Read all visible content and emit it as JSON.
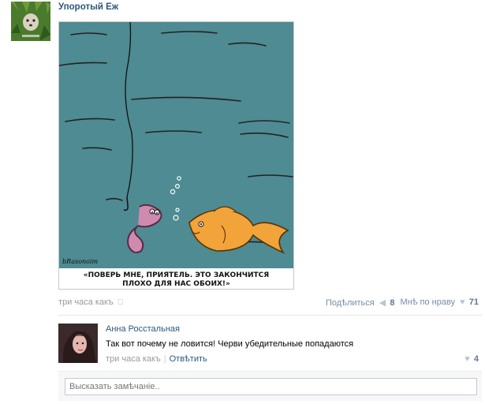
{
  "post": {
    "author": "Упоротый Еж",
    "caption_line1": "«ПОВЕРЬ МНЕ, ПРИЯТЕЛЬ. ЭТО ЗАКОНЧИТСЯ",
    "caption_line2": "ПЛОХО ДЛЯ НАС ОБОИХ!»",
    "signature": "bRasonoim",
    "time": "три часа какъ",
    "share_label": "Подѣлиться",
    "share_count": "8",
    "like_label": "Мнѣ по нраву",
    "like_count": "71"
  },
  "comment": {
    "author": "Анна Росстальная",
    "text": "Так вот почему не ловится! Черви убедительные попадаются",
    "time": "три часа какъ",
    "separator": "|",
    "reply_label": "Отвѣтить",
    "like_count": "4"
  },
  "reply_box": {
    "placeholder": "Высказать замѣчаніе.."
  },
  "icons": {
    "apple": "apple-icon",
    "share": "megaphone-icon",
    "like": "heart-icon"
  },
  "colors": {
    "link": "#2b587a",
    "water": "#4e8b92",
    "fish": "#f2a33a",
    "worm": "#d08ab0"
  }
}
